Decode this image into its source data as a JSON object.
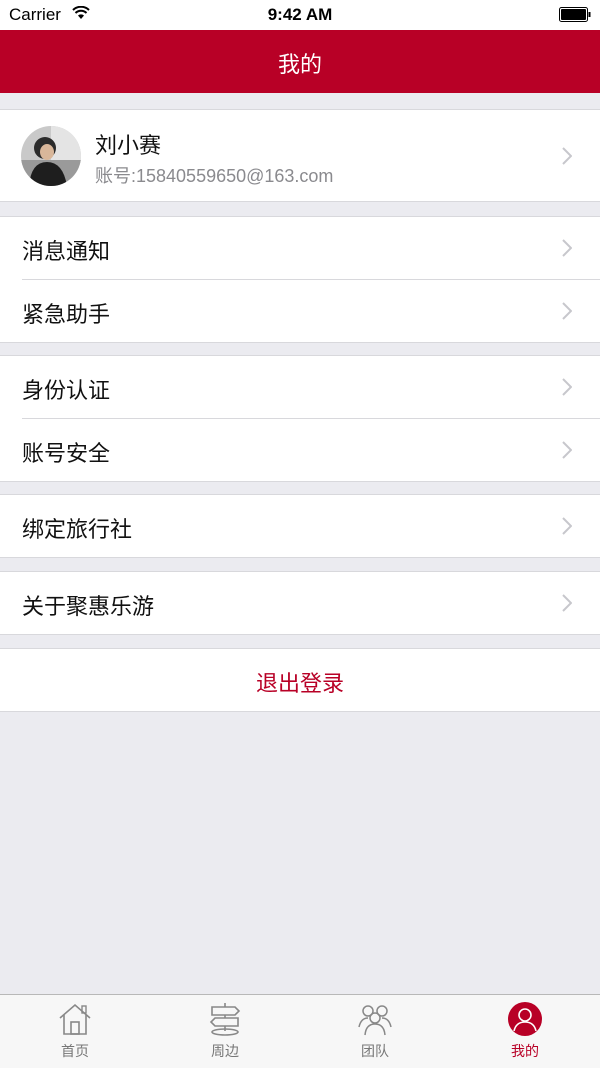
{
  "status_bar": {
    "carrier": "Carrier",
    "time": "9:42 AM"
  },
  "nav": {
    "title": "我的"
  },
  "profile": {
    "name": "刘小赛",
    "account": "账号:15840559650@163.com"
  },
  "menu": {
    "messages": "消息通知",
    "emergency": "紧急助手",
    "identity": "身份认证",
    "security": "账号安全",
    "agency": "绑定旅行社",
    "about": "关于聚惠乐游"
  },
  "logout": {
    "label": "退出登录"
  },
  "tabs": [
    {
      "label": "首页",
      "icon": "home-icon",
      "active": false
    },
    {
      "label": "周边",
      "icon": "signpost-icon",
      "active": false
    },
    {
      "label": "团队",
      "icon": "team-icon",
      "active": false
    },
    {
      "label": "我的",
      "icon": "user-icon",
      "active": true
    }
  ],
  "colors": {
    "brand": "#b80026",
    "background": "#ebebf0"
  }
}
